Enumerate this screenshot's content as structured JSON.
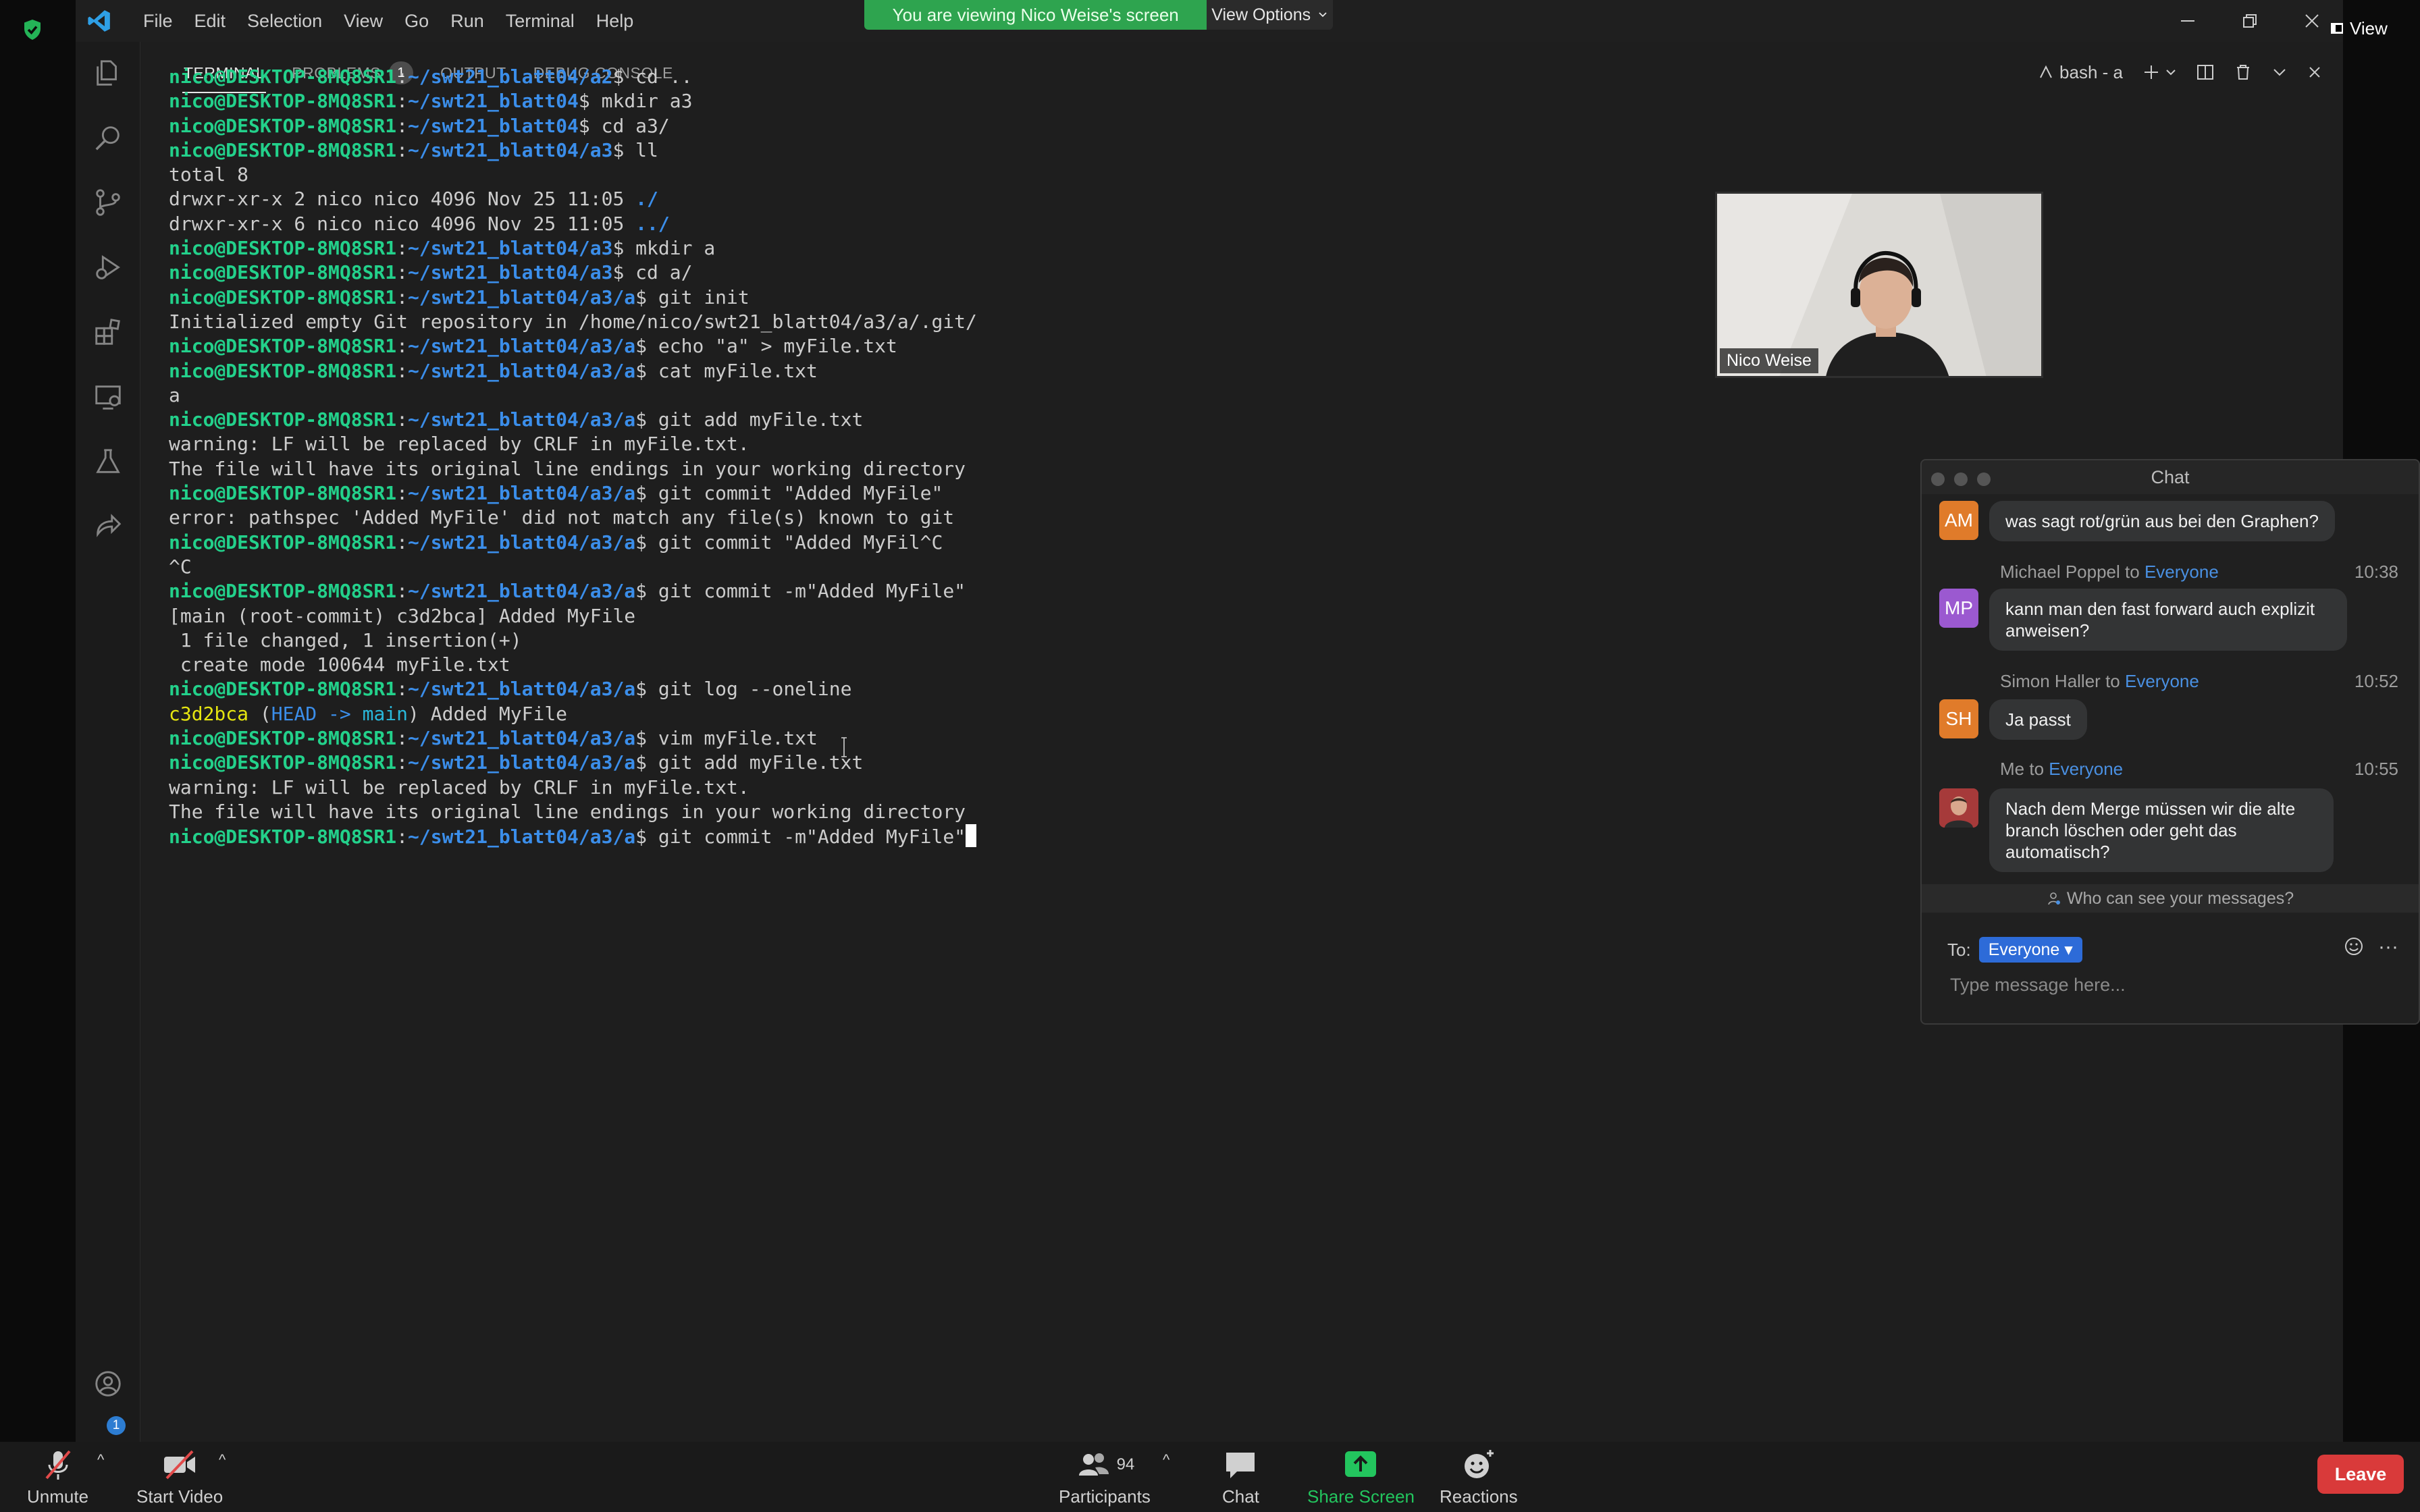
{
  "banner": {
    "message": "You are viewing Nico Weise's screen",
    "view_options": "View Options"
  },
  "view_button": "View",
  "menu": [
    "File",
    "Edit",
    "Selection",
    "View",
    "Go",
    "Run",
    "Terminal",
    "Help"
  ],
  "panel": {
    "tabs": [
      "TERMINAL",
      "PROBLEMS",
      "OUTPUT",
      "DEBUG CONSOLE"
    ],
    "problems_count": "1",
    "terminal_name": "bash - a"
  },
  "terminal": {
    "user": "nico@DESKTOP-8MQ8SR1",
    "lines": [
      {
        "kind": "prompt",
        "path": "~/swt21_blatt04/a2",
        "cmd": "cd .."
      },
      {
        "kind": "prompt",
        "path": "~/swt21_blatt04",
        "cmd": "mkdir a3"
      },
      {
        "kind": "prompt",
        "path": "~/swt21_blatt04",
        "cmd": "cd a3/"
      },
      {
        "kind": "prompt",
        "path": "~/swt21_blatt04/a3",
        "cmd": "ll"
      },
      {
        "kind": "text",
        "text": "total 8"
      },
      {
        "kind": "dir",
        "text": "drwxr-xr-x 2 nico nico 4096 Nov 25 11:05 ",
        "name": "./"
      },
      {
        "kind": "dir",
        "text": "drwxr-xr-x 6 nico nico 4096 Nov 25 11:05 ",
        "name": "../"
      },
      {
        "kind": "prompt",
        "path": "~/swt21_blatt04/a3",
        "cmd": "mkdir a"
      },
      {
        "kind": "prompt",
        "path": "~/swt21_blatt04/a3",
        "cmd": "cd a/"
      },
      {
        "kind": "prompt",
        "path": "~/swt21_blatt04/a3/a",
        "cmd": "git init"
      },
      {
        "kind": "text",
        "text": "Initialized empty Git repository in /home/nico/swt21_blatt04/a3/a/.git/"
      },
      {
        "kind": "prompt",
        "path": "~/swt21_blatt04/a3/a",
        "cmd": "echo \"a\" > myFile.txt"
      },
      {
        "kind": "prompt",
        "path": "~/swt21_blatt04/a3/a",
        "cmd": "cat myFile.txt"
      },
      {
        "kind": "text",
        "text": "a"
      },
      {
        "kind": "prompt",
        "path": "~/swt21_blatt04/a3/a",
        "cmd": "git add myFile.txt"
      },
      {
        "kind": "text",
        "text": "warning: LF will be replaced by CRLF in myFile.txt."
      },
      {
        "kind": "text",
        "text": "The file will have its original line endings in your working directory"
      },
      {
        "kind": "prompt",
        "path": "~/swt21_blatt04/a3/a",
        "cmd": "git commit \"Added MyFile\""
      },
      {
        "kind": "text",
        "text": "error: pathspec 'Added MyFile' did not match any file(s) known to git"
      },
      {
        "kind": "prompt",
        "path": "~/swt21_blatt04/a3/a",
        "cmd": "git commit \"Added MyFil^C"
      },
      {
        "kind": "text",
        "text": "^C"
      },
      {
        "kind": "prompt",
        "path": "~/swt21_blatt04/a3/a",
        "cmd": "git commit -m\"Added MyFile\""
      },
      {
        "kind": "text",
        "text": "[main (root-commit) c3d2bca] Added MyFile"
      },
      {
        "kind": "text",
        "text": " 1 file changed, 1 insertion(+)"
      },
      {
        "kind": "text",
        "text": " create mode 100644 myFile.txt"
      },
      {
        "kind": "prompt",
        "path": "~/swt21_blatt04/a3/a",
        "cmd": "git log --oneline"
      },
      {
        "kind": "log",
        "hash": "c3d2bca",
        "head": "HEAD",
        "arrow": "->",
        "branch": "main",
        "msg": "Added MyFile"
      },
      {
        "kind": "prompt",
        "path": "~/swt21_blatt04/a3/a",
        "cmd": "vim myFile.txt"
      },
      {
        "kind": "prompt",
        "path": "~/swt21_blatt04/a3/a",
        "cmd": "git add myFile.txt"
      },
      {
        "kind": "text",
        "text": "warning: LF will be replaced by CRLF in myFile.txt."
      },
      {
        "kind": "text",
        "text": "The file will have its original line endings in your working directory"
      },
      {
        "kind": "prompt",
        "path": "~/swt21_blatt04/a3/a",
        "cmd": "git commit -m\"Added MyFile\"",
        "cursor": true
      }
    ]
  },
  "video": {
    "name": "Nico Weise"
  },
  "chat": {
    "title": "Chat",
    "messages": [
      {
        "initials": "AM",
        "color": "#e07b2a",
        "text": "was sagt rot/grün aus bei den Graphen?"
      },
      {
        "initials": "MP",
        "color": "#9b59d0",
        "sender": "Michael Poppel",
        "to_word": "to",
        "to": "Everyone",
        "time": "10:38",
        "text": "kann man den fast forward auch explizit anweisen?"
      },
      {
        "initials": "SH",
        "color": "#e07b2a",
        "sender": "Simon Haller",
        "to_word": "to",
        "to": "Everyone",
        "time": "10:52",
        "text": "Ja passt"
      },
      {
        "initials": "",
        "color": "#b23b3b",
        "sender": "Me",
        "to_word": "to",
        "to": "Everyone",
        "time": "10:55",
        "text": "Nach dem Merge müssen wir die alte branch löschen oder geht das automatisch?"
      }
    ],
    "who_can_see": "Who can see your messages?",
    "to_label": "To:",
    "to_value": "Everyone",
    "placeholder": "Type message here..."
  },
  "toolbar": {
    "unmute": "Unmute",
    "start_video": "Start Video",
    "participants": "Participants",
    "participants_count": "94",
    "chat": "Chat",
    "share_screen": "Share Screen",
    "reactions": "Reactions",
    "leave": "Leave"
  },
  "colors": {
    "banner_green": "#2ea44f",
    "prompt_green": "#23d18b",
    "path_blue": "#3b8eea",
    "hash_yellow": "#e5e510",
    "leave_red": "#d93a3a",
    "share_green": "#23c55e",
    "chat_link_blue": "#4a90e2"
  }
}
